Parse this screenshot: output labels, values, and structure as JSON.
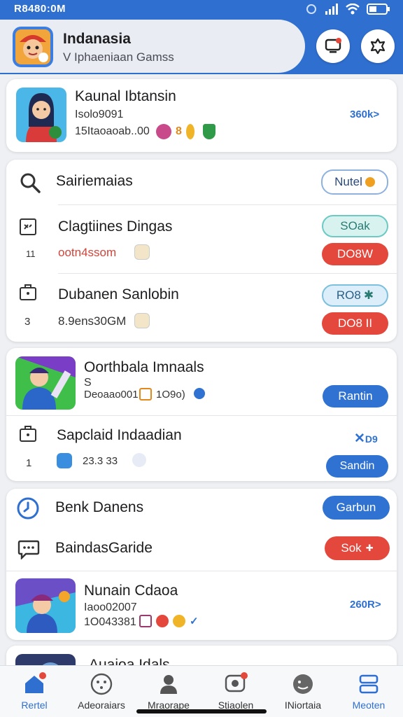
{
  "status": {
    "time": "R8480:0M"
  },
  "header": {
    "title": "Indanasia",
    "subtitle": "V Iphaeniaan Gamss"
  },
  "featured": {
    "title": "Kaunal Ibtansin",
    "line1": "Isolo9091",
    "line2": "15Itaoaoab..00",
    "badge_num": "8",
    "link": "360k>"
  },
  "list1": {
    "search_label": "Sairiemaias",
    "search_button": "Nutel",
    "items": [
      {
        "title": "Clagtiines Dingas",
        "index": "11",
        "meta": "ootn4ssom",
        "btn1": "SOak",
        "btn2": "DO8W"
      },
      {
        "title": "Dubanen Sanlobin",
        "index": "3",
        "meta": "8.9ens30GM",
        "btn1": "RO8",
        "btn2": "DO8 II"
      }
    ]
  },
  "list2": {
    "items": [
      {
        "title": "Oorthbala Imnaals",
        "sub": "S",
        "meta": "Deoaao001",
        "meta2": "1O9o)",
        "button": "Rantin"
      },
      {
        "title": "Sapclaid Indaadian",
        "index": "1",
        "meta": "23.3 33",
        "button": "Sandin",
        "icon_text": "D9"
      }
    ]
  },
  "list3": {
    "items": [
      {
        "title": "Benk Danens",
        "button": "Garbun"
      },
      {
        "title": "BaindasGaride",
        "button": "Sok"
      },
      {
        "title": "Nunain Cdaoa",
        "line1": "Iaoo02007",
        "line2": "1O043381",
        "link": "260R>"
      }
    ],
    "peek_title": "Auaioa Idals"
  },
  "nav": [
    {
      "label": "Rertel",
      "active": true
    },
    {
      "label": "Adeoraiars",
      "active": false
    },
    {
      "label": "Mraorape",
      "active": false
    },
    {
      "label": "Stiaolen",
      "active": false
    },
    {
      "label": "INiortaia",
      "active": false
    },
    {
      "label": "Meoten",
      "active": true
    }
  ],
  "colors": {
    "primary": "#2f6fd0",
    "danger": "#e4473c",
    "teal": "#6cc9c4"
  }
}
